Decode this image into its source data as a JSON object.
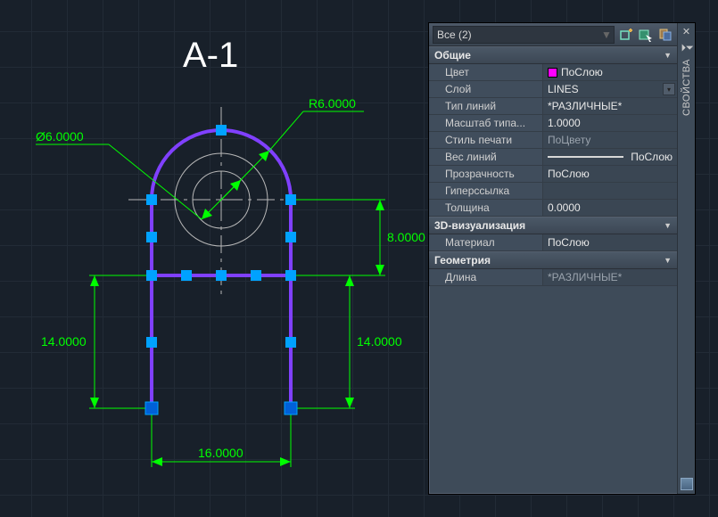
{
  "title": "А-1",
  "dimensions": {
    "radius": "R6.0000",
    "diameter": "Ø6.0000",
    "height_upper": "8.0000",
    "height_left": "14.0000",
    "height_right": "14.0000",
    "width": "16.0000"
  },
  "palette": {
    "selector": {
      "text": "Все (2)"
    },
    "side_label": "СВОЙСТВА",
    "sections": {
      "general": {
        "title": "Общие",
        "rows": {
          "color": {
            "label": "Цвет",
            "value": "ПоСлою"
          },
          "layer": {
            "label": "Слой",
            "value": "LINES"
          },
          "ltype": {
            "label": "Тип линий",
            "value": "*РАЗЛИЧНЫЕ*"
          },
          "ltscale": {
            "label": "Масштаб типа...",
            "value": "1.0000"
          },
          "plotstyle": {
            "label": "Стиль печати",
            "value": "ПоЦвету"
          },
          "lweight": {
            "label": "Вес линий",
            "value": "ПоСлою"
          },
          "transp": {
            "label": "Прозрачность",
            "value": "ПоСлою"
          },
          "hyper": {
            "label": "Гиперссылка",
            "value": ""
          },
          "thick": {
            "label": "Толщина",
            "value": "0.0000"
          }
        }
      },
      "visual3d": {
        "title": "3D-визуализация",
        "rows": {
          "material": {
            "label": "Материал",
            "value": "ПоСлою"
          }
        }
      },
      "geometry": {
        "title": "Геометрия",
        "rows": {
          "length": {
            "label": "Длина",
            "value": "*РАЗЛИЧНЫЕ*"
          }
        }
      }
    }
  }
}
